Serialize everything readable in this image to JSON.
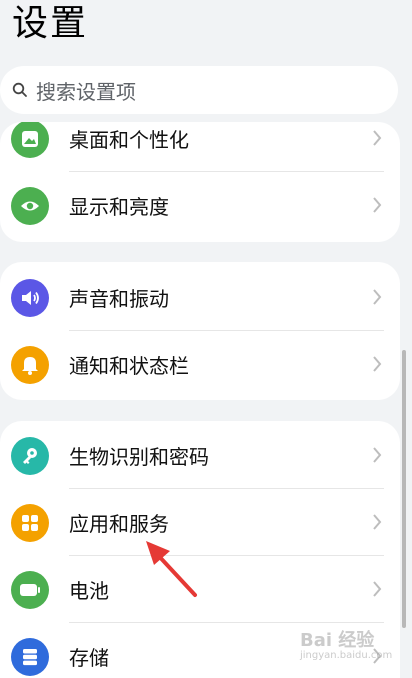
{
  "header": {
    "title": "设置"
  },
  "search": {
    "placeholder": "搜索设置项",
    "icon": "search-icon"
  },
  "groups": [
    {
      "items": [
        {
          "label": "桌面和个性化",
          "icon": "wallpaper-icon",
          "color": "#4caf50"
        },
        {
          "label": "显示和亮度",
          "icon": "eye-icon",
          "color": "#4caf50"
        }
      ]
    },
    {
      "items": [
        {
          "label": "声音和振动",
          "icon": "speaker-icon",
          "color": "#5b57e6"
        },
        {
          "label": "通知和状态栏",
          "icon": "bell-icon",
          "color": "#f4a100"
        }
      ]
    },
    {
      "items": [
        {
          "label": "生物识别和密码",
          "icon": "key-icon",
          "color": "#27b8a8"
        },
        {
          "label": "应用和服务",
          "icon": "apps-icon",
          "color": "#f4a100"
        },
        {
          "label": "电池",
          "icon": "battery-icon",
          "color": "#4caf50"
        },
        {
          "label": "存储",
          "icon": "storage-icon",
          "color": "#2f6bdc"
        }
      ]
    }
  ],
  "annotation": {
    "arrow_color": "#e53935"
  },
  "watermark": {
    "text": "Bai 经验",
    "sub": "jingyan.baidu.com"
  }
}
